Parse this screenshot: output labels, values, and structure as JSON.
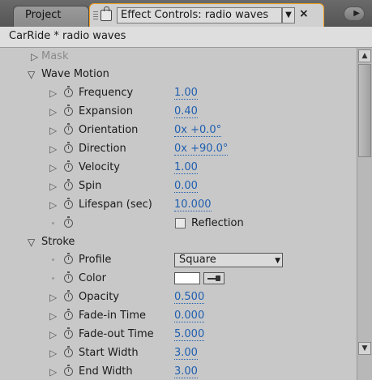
{
  "tabs": {
    "project_label": "Project",
    "active_label": "Effect Controls: radio waves",
    "close_glyph": "×",
    "dropdown_glyph": "▼",
    "menu_glyph": "▶"
  },
  "header": {
    "comp_title": "CarRide * radio waves"
  },
  "controls": {
    "mask": {
      "label": "Mask"
    },
    "wave_motion": {
      "label": "Wave Motion",
      "frequency": {
        "label": "Frequency",
        "value": "1.00"
      },
      "expansion": {
        "label": "Expansion",
        "value": "0.40"
      },
      "orientation": {
        "label": "Orientation",
        "value": "0x +0.0°"
      },
      "direction": {
        "label": "Direction",
        "value": "0x +90.0°"
      },
      "velocity": {
        "label": "Velocity",
        "value": "1.00"
      },
      "spin": {
        "label": "Spin",
        "value": "0.00"
      },
      "lifespan": {
        "label": "Lifespan (sec)",
        "value": "10.000"
      },
      "reflection": {
        "label": "Reflection",
        "checked": false
      }
    },
    "stroke": {
      "label": "Stroke",
      "profile": {
        "label": "Profile",
        "value": "Square"
      },
      "color": {
        "label": "Color",
        "value": "#ffffff"
      },
      "opacity": {
        "label": "Opacity",
        "value": "0.500"
      },
      "fade_in": {
        "label": "Fade-in Time",
        "value": "0.000"
      },
      "fade_out": {
        "label": "Fade-out Time",
        "value": "5.000"
      },
      "start_width": {
        "label": "Start Width",
        "value": "3.00"
      },
      "end_width": {
        "label": "End Width",
        "value": "3.00"
      }
    }
  },
  "scrollbar": {
    "up_glyph": "▲",
    "down_glyph": "▼"
  },
  "icons": {
    "twirl_closed": "▷",
    "twirl_open": "▽",
    "stopwatch": "stopwatch-icon",
    "eyedropper": "eyedropper-icon",
    "lock": "lock-icon"
  },
  "colors": {
    "value_blue": "#1f5fb0",
    "active_tab_outline": "#f0a020",
    "panel_bg": "#c8c8c8"
  }
}
